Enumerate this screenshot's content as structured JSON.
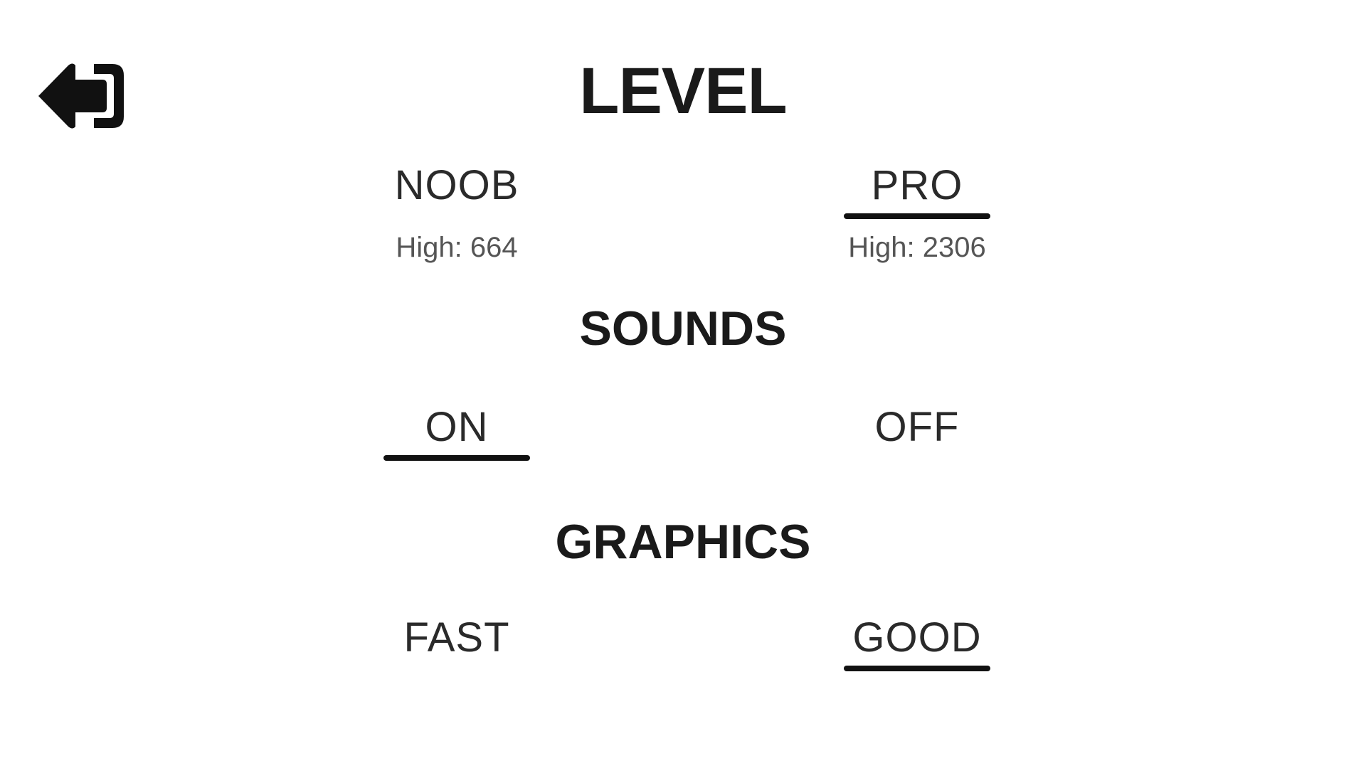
{
  "back": {
    "icon": "back-exit-arrow-icon"
  },
  "level": {
    "heading": "LEVEL",
    "options": [
      {
        "label": "NOOB",
        "highscore": "High: 664",
        "selected": false
      },
      {
        "label": "PRO",
        "highscore": "High: 2306",
        "selected": true
      }
    ]
  },
  "sounds": {
    "heading": "SOUNDS",
    "options": [
      {
        "label": "ON",
        "selected": true
      },
      {
        "label": "OFF",
        "selected": false
      }
    ]
  },
  "graphics": {
    "heading": "GRAPHICS",
    "options": [
      {
        "label": "FAST",
        "selected": false
      },
      {
        "label": "GOOD",
        "selected": true
      }
    ]
  },
  "colors": {
    "text": "#1a1a1a",
    "underline": "#111111",
    "background": "#ffffff"
  }
}
